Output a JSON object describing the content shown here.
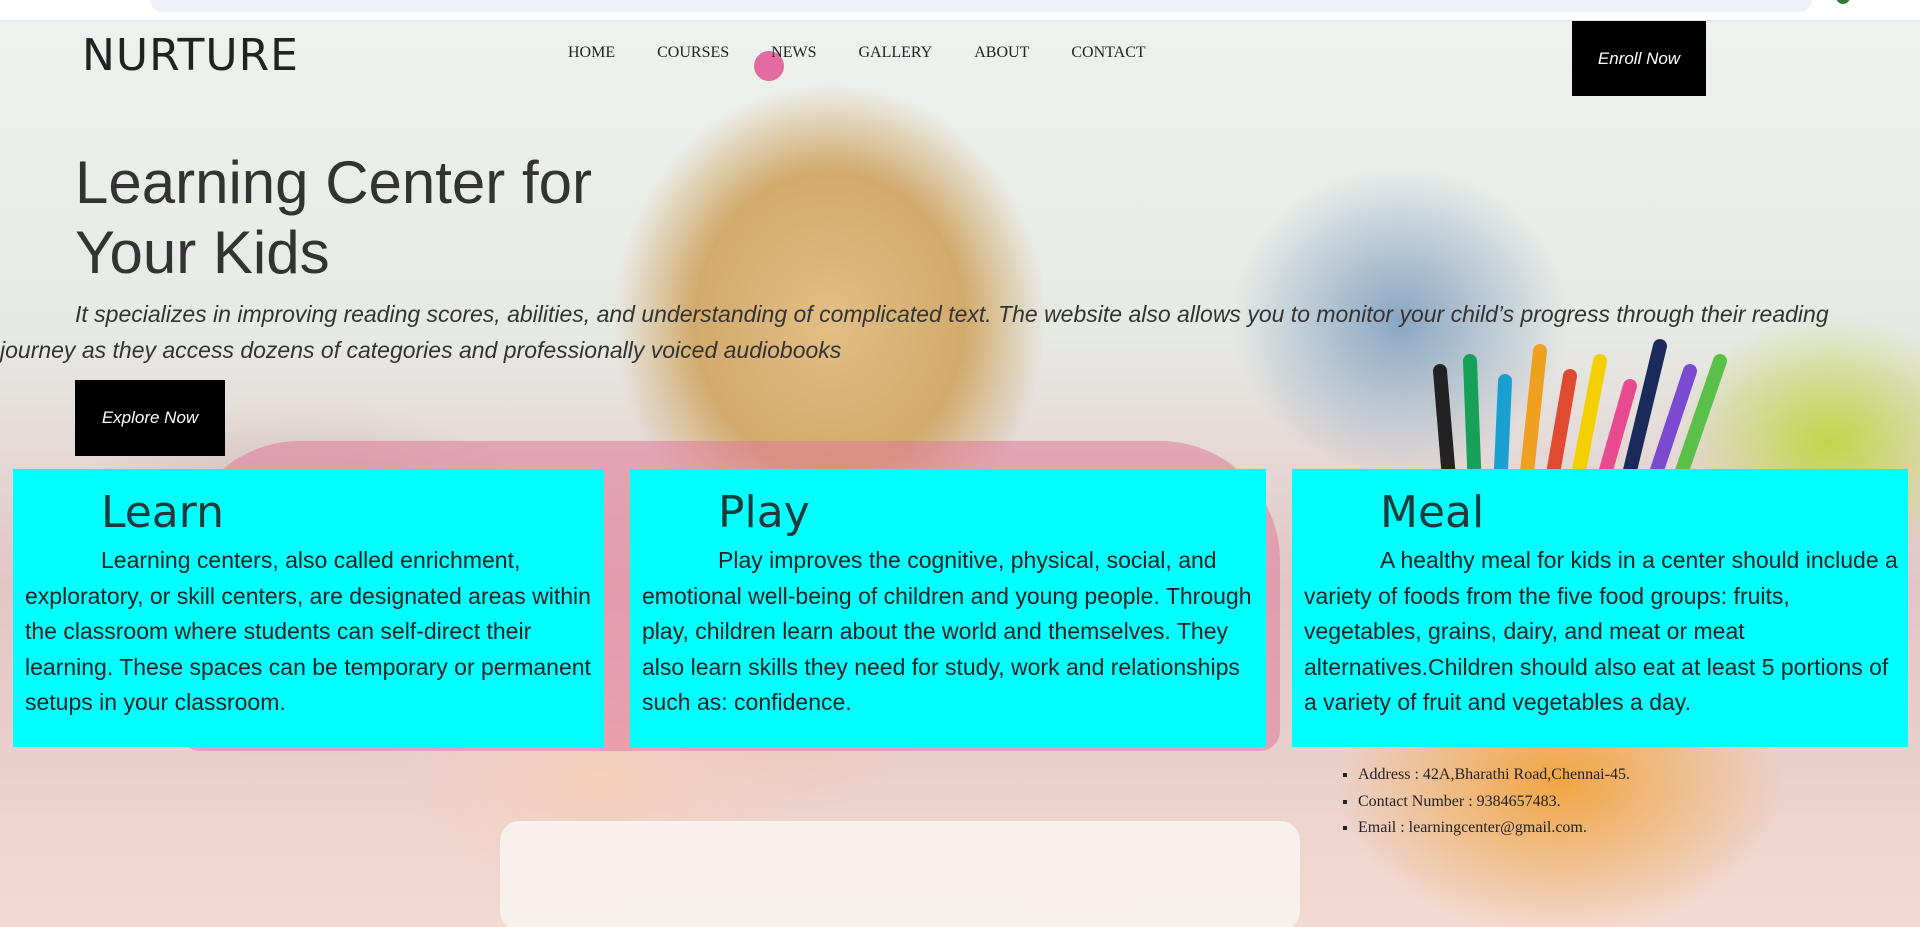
{
  "brand": {
    "logo": "NURTURE"
  },
  "nav": [
    {
      "label": "HOME"
    },
    {
      "label": "COURSES"
    },
    {
      "label": "NEWS"
    },
    {
      "label": "GALLERY"
    },
    {
      "label": "ABOUT"
    },
    {
      "label": "CONTACT"
    }
  ],
  "header": {
    "enroll_label": "Enroll Now"
  },
  "hero": {
    "title_line1": "Learning Center for",
    "title_line2": "Your Kids",
    "lead": "It specializes in improving reading scores, abilities, and understanding of complicated text. The website also allows you to monitor your child’s progress through their reading journey as they access dozens of categories and professionally voiced audiobooks",
    "explore_label": "Explore Now"
  },
  "cards": [
    {
      "title": "Learn",
      "text": "Learning centers, also called enrichment, exploratory, or skill centers, are designated areas within the classroom where students can self-direct their learning. These spaces can be temporary or permanent setups in your classroom."
    },
    {
      "title": "Play",
      "text": "Play improves the cognitive, physical, social, and emotional well-being of children and young people. Through play, children learn about the world and themselves. They also learn skills they need for study, work and relationships such as: confidence."
    },
    {
      "title": "Meal",
      "text": "A healthy meal for kids in a center should include a variety of foods from the five food groups: fruits, vegetables, grains, dairy, and meat or meat alternatives.Children should also eat at least 5 portions of a variety of fruit and vegetables a day."
    }
  ],
  "contact": [
    {
      "text": "Address : 42A,Bharathi Road,Chennai-45."
    },
    {
      "text": "Contact Number : 9384657483."
    },
    {
      "text": "Email : learningcenter@gmail.com."
    }
  ],
  "colors": {
    "card_bg": "#00ffff",
    "button_bg": "#000000"
  }
}
